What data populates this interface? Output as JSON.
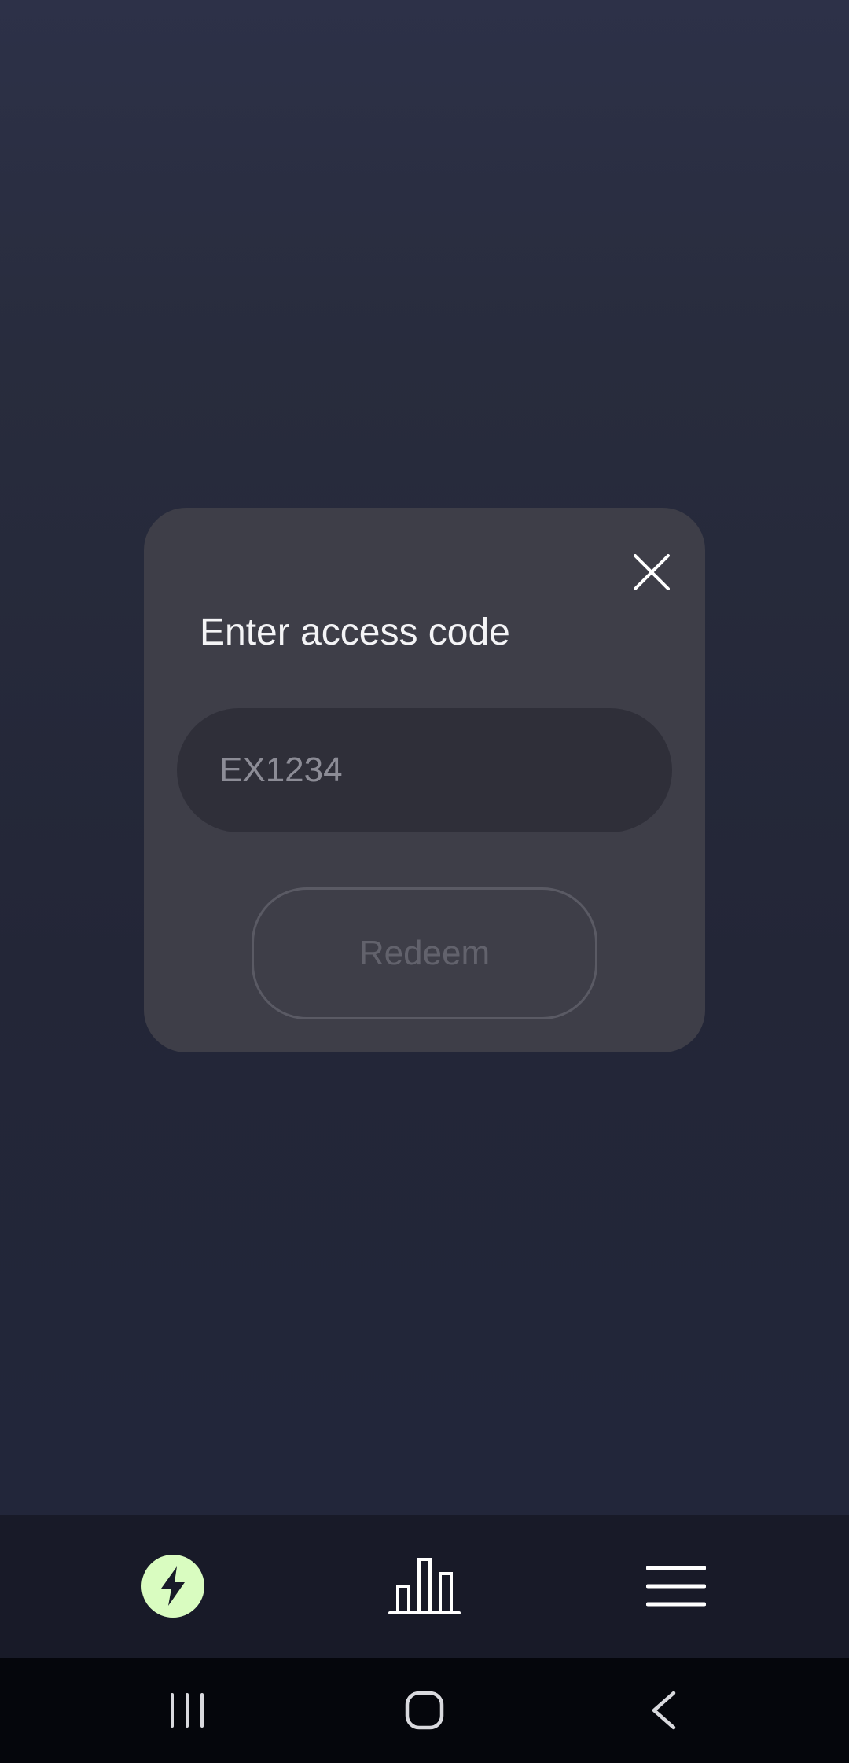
{
  "modal": {
    "title": "Enter access code",
    "input_placeholder": "EX1234",
    "input_value": "",
    "redeem_label": "Redeem"
  },
  "bottom_nav": {
    "items": [
      {
        "icon": "lightning-bolt-icon",
        "active": true
      },
      {
        "icon": "bar-chart-icon",
        "active": false
      },
      {
        "icon": "hamburger-menu-icon",
        "active": false
      }
    ],
    "accent_color": "#d9fcc0"
  },
  "system_nav": {
    "items": [
      {
        "icon": "recents-icon"
      },
      {
        "icon": "home-icon"
      },
      {
        "icon": "back-icon"
      }
    ]
  }
}
